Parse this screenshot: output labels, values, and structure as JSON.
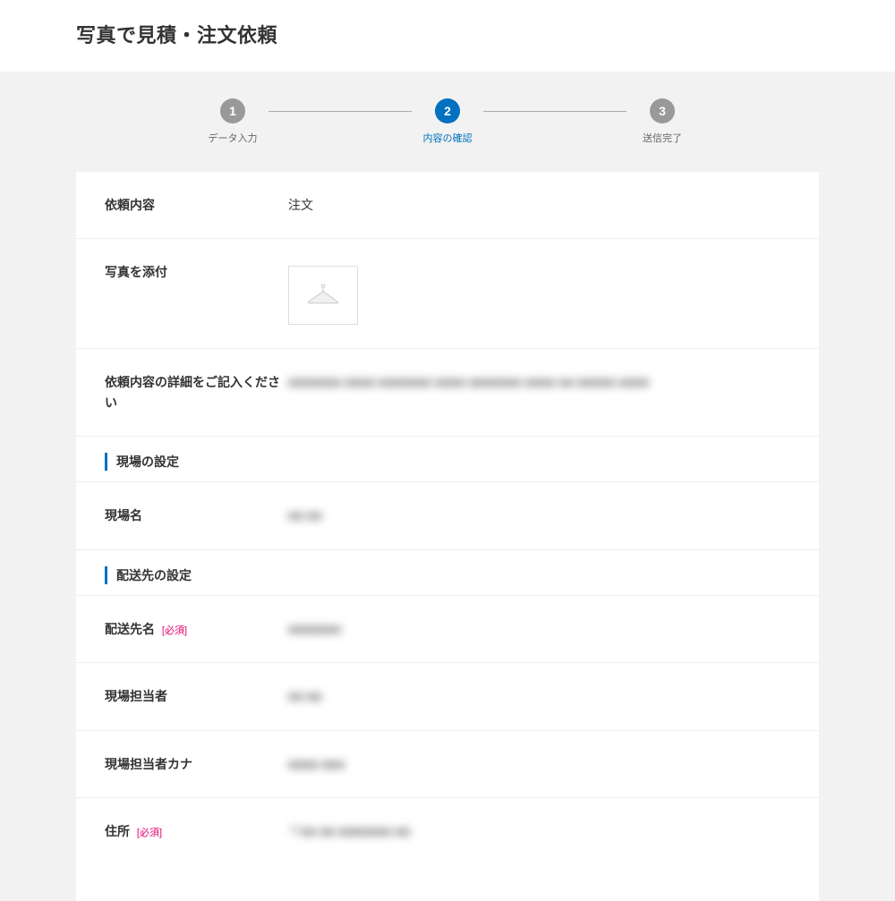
{
  "page": {
    "title": "写真で見積・注文依頼"
  },
  "stepper": {
    "steps": [
      {
        "num": "1",
        "label": "データ入力",
        "active": false
      },
      {
        "num": "2",
        "label": "内容の確認",
        "active": true
      },
      {
        "num": "3",
        "label": "送信完了",
        "active": false
      }
    ]
  },
  "labels": {
    "request_type": "依頼内容",
    "attach_photo": "写真を添付",
    "detail_prompt": "依頼内容の詳細をご記入ください",
    "section_site": "現場の設定",
    "site_name": "現場名",
    "section_delivery": "配送先の設定",
    "delivery_name": "配送先名",
    "site_contact": "現場担当者",
    "site_contact_kana": "現場担当者カナ",
    "address": "住所",
    "required": "[必須]"
  },
  "values": {
    "request_type": "注文",
    "detail_text": "■■■■■■■ ■■■■ ■■■■■■■ ■■■■ ■■■■■■■ ■■■■ ■■ ■■■■■ ■■■■",
    "site_name": "■■ ■■",
    "delivery_name": "■■■■■■■",
    "site_contact": "■■  ■■",
    "site_contact_kana": "■■■■  ■■■",
    "address": "〒■■-■■ ■■■■■■■ ■■"
  }
}
